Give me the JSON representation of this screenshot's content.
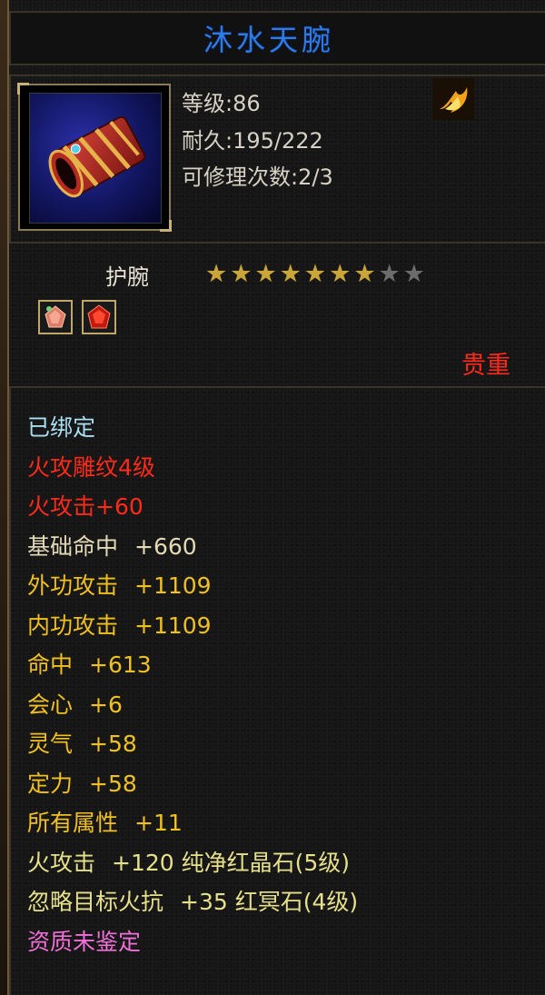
{
  "item": {
    "name": "沐水天腕",
    "level_label": "等级:86",
    "durability_label": "耐久:195/222",
    "repair_label": "可修理次数:2/3",
    "type": "护腕",
    "stars_total": 9,
    "stars_filled": 7,
    "value_tag": "贵重",
    "slot_icons": [
      "pink-gem-icon",
      "red-gem-icon"
    ]
  },
  "colors": {
    "title": "#2e7be8",
    "bound": "#a9dff0",
    "red": "#ff2a1a",
    "base_stat": "#e4d9b6",
    "bonus_stat": "#f0c020",
    "gem_stat": "#e6e08a",
    "unidentified": "#f070d8",
    "value_tag": "#ff2a1a"
  },
  "attributes": [
    {
      "label": "已绑定",
      "value": "",
      "color": "#a9dff0"
    },
    {
      "label": "火攻雕纹4级",
      "value": "",
      "color": "#ff2a1a"
    },
    {
      "label": "火攻击+60",
      "value": "",
      "color": "#ff2a1a"
    },
    {
      "label": "基础命中",
      "value": "+660",
      "color": "#e4d9b6"
    },
    {
      "label": "外功攻击",
      "value": "+1109",
      "color": "#f0c020"
    },
    {
      "label": "内功攻击",
      "value": "+1109",
      "color": "#f0c020"
    },
    {
      "label": "命中",
      "value": "+613",
      "color": "#f0c020"
    },
    {
      "label": "会心",
      "value": "+6",
      "color": "#f0c020"
    },
    {
      "label": "灵气",
      "value": "+58",
      "color": "#f0c020"
    },
    {
      "label": "定力",
      "value": "+58",
      "color": "#f0c020"
    },
    {
      "label": "所有属性",
      "value": "+11",
      "color": "#f0c020"
    },
    {
      "label": "火攻击",
      "value": "+120 纯净红晶石(5级)",
      "color": "#e6e08a"
    },
    {
      "label": "忽略目标火抗",
      "value": "+35 红冥石(4级)",
      "color": "#e6e08a"
    },
    {
      "label": "资质未鉴定",
      "value": "",
      "color": "#f070d8"
    }
  ]
}
